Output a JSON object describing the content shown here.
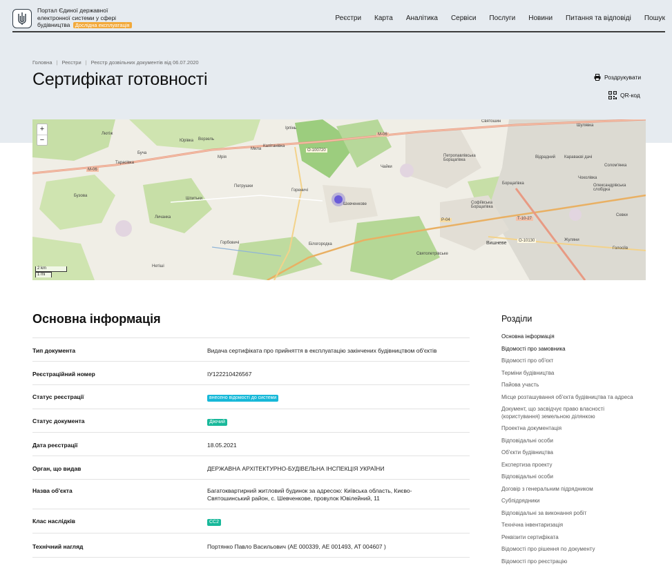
{
  "header": {
    "portal_title": "Портал Єдиної державної електронної системи у сфері будівництва",
    "beta_badge": "Дослідна експлуатація",
    "nav": [
      "Реєстри",
      "Карта",
      "Аналітика",
      "Сервіси",
      "Послуги",
      "Новини",
      "Питання та відповіді",
      "Пошук"
    ]
  },
  "breadcrumb": [
    "Головна",
    "Реєстри",
    "Реєстр дозвільних документів від 06.07.2020"
  ],
  "page_title": "Сертифікат готовності",
  "actions": {
    "print": "Роздрукувати",
    "qr": "QR-код"
  },
  "map": {
    "zoom_in": "+",
    "zoom_out": "−",
    "scale_km": "2 km",
    "scale_mi": "1 mi",
    "places": [
      "Святошин",
      "Шулявка",
      "Вишневе",
      "Шевченкове",
      "Горбовичі",
      "Петрушки",
      "Гореничі",
      "Ірпінь",
      "Мила",
      "Личанка",
      "Нетіші",
      "Жуляни",
      "Чайки",
      "Голосіїв",
      "Бузова",
      "Шпитьки",
      "Юрівка",
      "Ворзель",
      "Борщагівка",
      "Білогородка",
      "Софіївська Борщагівка",
      "Петропавлівська Борщагівка",
      "Святопетрівське",
      "Караваєві дачі",
      "Відрадний",
      "Солом'янка",
      "Чоколівка",
      "Олександрівська слобідка",
      "Севки",
      "Тарасівка",
      "Капітанівка",
      "Мрія",
      "Лютіж",
      "Бучa"
    ],
    "roads": [
      "М-06",
      "О-100720",
      "Р-04",
      "Т-10-27",
      "О-10130"
    ],
    "marker_color": "#6a5bd8"
  },
  "main": {
    "section_title": "Основна інформація",
    "rows": [
      {
        "label": "Тип документа",
        "value": "Видача сертифіката про прийняття в експлуатацію закінчених будівництвом об'єктів"
      },
      {
        "label": "Реєстраційний номер",
        "value": "ІУ122210426567"
      },
      {
        "label": "Статус реєстрації",
        "value": "внесено відомості до системи",
        "badge": "#16b8d8"
      },
      {
        "label": "Статус документа",
        "value": "Діючий",
        "badge": "#18b89a"
      },
      {
        "label": "Дата реєстрації",
        "value": "18.05.2021"
      },
      {
        "label": "Орган, що видав",
        "value": "ДЕРЖАВНА АРХІТЕКТУРНО-БУДІВЕЛЬНА ІНСПЕКЦІЯ УКРАЇНИ"
      },
      {
        "label": "Назва об'єкта",
        "value": "Багатоквартирний житловий будинок за адресою: Київська область, Києво-Святошинський район, с. Шевченкове, провулок Ювілейний, 11"
      },
      {
        "label": "Клас наслідків",
        "value": "СС2",
        "badge": "#18b89a"
      },
      {
        "label": "Технічний нагляд",
        "value": "Портянко Павло Васильович (АЕ 000339, АЕ 001493, АТ 004607 )"
      }
    ]
  },
  "sidebar": {
    "title": "Розділи",
    "items": [
      "Основна інформація",
      "Відомості про замовника",
      "Відомості про об'єкт",
      "Терміни будівництва",
      "Пайова участь",
      "Місце розташування об'єкта будівництва та адреса",
      "Документ, що засвідчує право власності (користування) земельною ділянкою",
      "Проектна документація",
      "Відповідальні особи",
      "Об'єкти будівництва",
      "Експертиза проекту",
      "Відповідальні особи",
      "Договір з генеральним підрядником",
      "Субпідрядники",
      "Відповідальні за виконання робіт",
      "Технічна інвентаризація",
      "Реквізити сертифіката",
      "Відомості про рішення по документу",
      "Відомості про реєстрацію"
    ]
  }
}
